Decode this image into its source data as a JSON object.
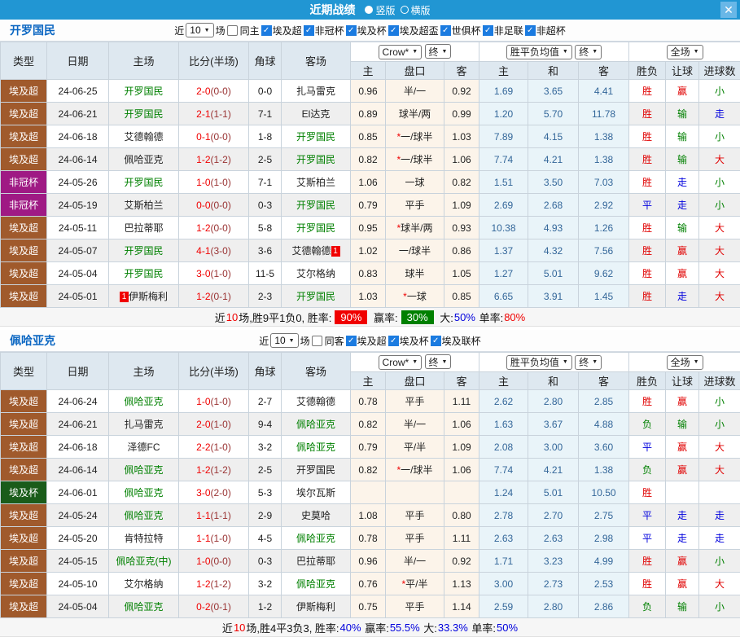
{
  "titlebar": {
    "title": "近期战绩",
    "radios": [
      {
        "label": "竖版",
        "selected": true
      },
      {
        "label": "横版",
        "selected": false
      }
    ],
    "close": "✕"
  },
  "table_header": {
    "main": [
      "类型",
      "日期",
      "主场",
      "比分(半场)",
      "角球",
      "客场"
    ],
    "selects_odds": [
      "Crow*",
      "终"
    ],
    "selects_avg": [
      "胜平负均值",
      "终"
    ],
    "selects_period": [
      "全场"
    ],
    "sub": [
      "主",
      "盘口",
      "客",
      "主",
      "和",
      "客",
      "胜负",
      "让球",
      "进球数"
    ]
  },
  "value_colors": {
    "胜": "v-red",
    "平": "v-blue",
    "负": "v-green",
    "赢": "v-red",
    "输": "v-green",
    "走": "v-blue",
    "大": "v-red",
    "小": "v-green"
  },
  "comp_colors": {
    "埃及超": "#a05a2c",
    "非冠杯": "#9f1a84",
    "埃及杯": "#1a5c1a"
  },
  "sections": [
    {
      "team": "开罗国民",
      "filter": {
        "prefix": "近",
        "count": "10",
        "suffix": "场",
        "same": "同主",
        "same_checked": false,
        "leagues": [
          "埃及超",
          "非冠杯",
          "埃及杯",
          "埃及超盃",
          "世俱杯",
          "非足联",
          "非超杯"
        ]
      },
      "rows": [
        {
          "type": "埃及超",
          "date": "24-06-25",
          "home": "开罗国民",
          "home_green": true,
          "score": "2-0",
          "half": "(0-0)",
          "corner": "0-0",
          "away": "扎马雷克",
          "away_green": false,
          "o1": "0.96",
          "star": false,
          "line": "半/一",
          "o2": "0.92",
          "a1": "1.69",
          "a2": "3.65",
          "a3": "4.41",
          "r": "胜",
          "h": "赢",
          "g": "小"
        },
        {
          "type": "埃及超",
          "date": "24-06-21",
          "home": "开罗国民",
          "home_green": true,
          "score": "2-1",
          "half": "(1-1)",
          "corner": "7-1",
          "away": "El达克",
          "away_green": false,
          "o1": "0.89",
          "star": false,
          "line": "球半/两",
          "o2": "0.99",
          "a1": "1.20",
          "a2": "5.70",
          "a3": "11.78",
          "r": "胜",
          "h": "输",
          "g": "走"
        },
        {
          "type": "埃及超",
          "date": "24-06-18",
          "home": "艾德翰德",
          "home_green": false,
          "score": "0-1",
          "half": "(0-0)",
          "corner": "1-8",
          "away": "开罗国民",
          "away_green": true,
          "o1": "0.85",
          "star": true,
          "line": "一/球半",
          "o2": "1.03",
          "a1": "7.89",
          "a2": "4.15",
          "a3": "1.38",
          "r": "胜",
          "h": "输",
          "g": "小"
        },
        {
          "type": "埃及超",
          "date": "24-06-14",
          "home": "佩哈亚克",
          "home_green": false,
          "score": "1-2",
          "half": "(1-2)",
          "corner": "2-5",
          "away": "开罗国民",
          "away_green": true,
          "o1": "0.82",
          "star": true,
          "line": "一/球半",
          "o2": "1.06",
          "a1": "7.74",
          "a2": "4.21",
          "a3": "1.38",
          "r": "胜",
          "h": "输",
          "g": "大"
        },
        {
          "type": "非冠杯",
          "date": "24-05-26",
          "home": "开罗国民",
          "home_green": true,
          "score": "1-0",
          "half": "(1-0)",
          "corner": "7-1",
          "away": "艾斯柏兰",
          "away_green": false,
          "o1": "1.06",
          "star": false,
          "line": "一球",
          "o2": "0.82",
          "a1": "1.51",
          "a2": "3.50",
          "a3": "7.03",
          "r": "胜",
          "h": "走",
          "g": "小"
        },
        {
          "type": "非冠杯",
          "date": "24-05-19",
          "home": "艾斯柏兰",
          "home_green": false,
          "score": "0-0",
          "half": "(0-0)",
          "corner": "0-3",
          "away": "开罗国民",
          "away_green": true,
          "o1": "0.79",
          "star": false,
          "line": "平手",
          "o2": "1.09",
          "a1": "2.69",
          "a2": "2.68",
          "a3": "2.92",
          "r": "平",
          "h": "走",
          "g": "小"
        },
        {
          "type": "埃及超",
          "date": "24-05-11",
          "home": "巴拉蒂耶",
          "home_green": false,
          "score": "1-2",
          "half": "(0-0)",
          "corner": "5-8",
          "away": "开罗国民",
          "away_green": true,
          "o1": "0.95",
          "star": true,
          "line": "球半/两",
          "o2": "0.93",
          "a1": "10.38",
          "a2": "4.93",
          "a3": "1.26",
          "r": "胜",
          "h": "输",
          "g": "大"
        },
        {
          "type": "埃及超",
          "date": "24-05-07",
          "home": "开罗国民",
          "home_green": true,
          "score": "4-1",
          "half": "(3-0)",
          "corner": "3-6",
          "away": "艾德翰德",
          "away_green": false,
          "away_badge": "1",
          "o1": "1.02",
          "star": false,
          "line": "一/球半",
          "o2": "0.86",
          "a1": "1.37",
          "a2": "4.32",
          "a3": "7.56",
          "r": "胜",
          "h": "赢",
          "g": "大"
        },
        {
          "type": "埃及超",
          "date": "24-05-04",
          "home": "开罗国民",
          "home_green": true,
          "score": "3-0",
          "half": "(1-0)",
          "corner": "11-5",
          "away": "艾尔格纳",
          "away_green": false,
          "o1": "0.83",
          "star": false,
          "line": "球半",
          "o2": "1.05",
          "a1": "1.27",
          "a2": "5.01",
          "a3": "9.62",
          "r": "胜",
          "h": "赢",
          "g": "大"
        },
        {
          "type": "埃及超",
          "date": "24-05-01",
          "home": "伊斯梅利",
          "home_green": false,
          "home_badge": "1",
          "score": "1-2",
          "half": "(0-1)",
          "corner": "2-3",
          "away": "开罗国民",
          "away_green": true,
          "o1": "1.03",
          "star": true,
          "line": "一球",
          "o2": "0.85",
          "a1": "6.65",
          "a2": "3.91",
          "a3": "1.45",
          "r": "胜",
          "h": "走",
          "g": "大"
        }
      ],
      "summary": [
        {
          "t": "近"
        },
        {
          "t": "10",
          "s": "red"
        },
        {
          "t": "场,胜9平1负0, 胜率:"
        },
        {
          "t": "90%",
          "s": "badge-red"
        },
        {
          "t": " 赢率:"
        },
        {
          "t": "30%",
          "s": "badge-green"
        },
        {
          "t": " 大:"
        },
        {
          "t": "50%",
          "s": "blue"
        },
        {
          "t": " 单率:"
        },
        {
          "t": "80%",
          "s": "red"
        }
      ]
    },
    {
      "team": "佩哈亚克",
      "filter": {
        "prefix": "近",
        "count": "10",
        "suffix": "场",
        "same": "同客",
        "same_checked": false,
        "leagues": [
          "埃及超",
          "埃及杯",
          "埃及联杯"
        ]
      },
      "rows": [
        {
          "type": "埃及超",
          "date": "24-06-24",
          "home": "佩哈亚克",
          "home_green": true,
          "score": "1-0",
          "half": "(1-0)",
          "corner": "2-7",
          "away": "艾德翰德",
          "away_green": false,
          "o1": "0.78",
          "star": false,
          "line": "平手",
          "o2": "1.11",
          "a1": "2.62",
          "a2": "2.80",
          "a3": "2.85",
          "r": "胜",
          "h": "赢",
          "g": "小"
        },
        {
          "type": "埃及超",
          "date": "24-06-21",
          "home": "扎马雷克",
          "home_green": false,
          "score": "2-0",
          "half": "(1-0)",
          "corner": "9-4",
          "away": "佩哈亚克",
          "away_green": true,
          "o1": "0.82",
          "star": false,
          "line": "半/一",
          "o2": "1.06",
          "a1": "1.63",
          "a2": "3.67",
          "a3": "4.88",
          "r": "负",
          "h": "输",
          "g": "小"
        },
        {
          "type": "埃及超",
          "date": "24-06-18",
          "home": "泽德FC",
          "home_green": false,
          "score": "2-2",
          "half": "(1-0)",
          "corner": "3-2",
          "away": "佩哈亚克",
          "away_green": true,
          "o1": "0.79",
          "star": false,
          "line": "平/半",
          "o2": "1.09",
          "a1": "2.08",
          "a2": "3.00",
          "a3": "3.60",
          "r": "平",
          "h": "赢",
          "g": "大"
        },
        {
          "type": "埃及超",
          "date": "24-06-14",
          "home": "佩哈亚克",
          "home_green": true,
          "score": "1-2",
          "half": "(1-2)",
          "corner": "2-5",
          "away": "开罗国民",
          "away_green": false,
          "o1": "0.82",
          "star": true,
          "line": "一/球半",
          "o2": "1.06",
          "a1": "7.74",
          "a2": "4.21",
          "a3": "1.38",
          "r": "负",
          "h": "赢",
          "g": "大"
        },
        {
          "type": "埃及杯",
          "date": "24-06-01",
          "home": "佩哈亚克",
          "home_green": true,
          "score": "3-0",
          "half": "(2-0)",
          "corner": "5-3",
          "away": "埃尔瓦斯",
          "away_green": false,
          "o1": "",
          "star": false,
          "line": "",
          "o2": "",
          "a1": "1.24",
          "a2": "5.01",
          "a3": "10.50",
          "r": "胜",
          "h": "",
          "g": ""
        },
        {
          "type": "埃及超",
          "date": "24-05-24",
          "home": "佩哈亚克",
          "home_green": true,
          "score": "1-1",
          "half": "(1-1)",
          "corner": "2-9",
          "away": "史莫哈",
          "away_green": false,
          "o1": "1.08",
          "star": false,
          "line": "平手",
          "o2": "0.80",
          "a1": "2.78",
          "a2": "2.70",
          "a3": "2.75",
          "r": "平",
          "h": "走",
          "g": "走"
        },
        {
          "type": "埃及超",
          "date": "24-05-20",
          "home": "肯特拉特",
          "home_green": false,
          "score": "1-1",
          "half": "(1-0)",
          "corner": "4-5",
          "away": "佩哈亚克",
          "away_green": true,
          "o1": "0.78",
          "star": false,
          "line": "平手",
          "o2": "1.11",
          "a1": "2.63",
          "a2": "2.63",
          "a3": "2.98",
          "r": "平",
          "h": "走",
          "g": "走"
        },
        {
          "type": "埃及超",
          "date": "24-05-15",
          "home": "佩哈亚克(中)",
          "home_green": true,
          "score": "1-0",
          "half": "(0-0)",
          "corner": "0-3",
          "away": "巴拉蒂耶",
          "away_green": false,
          "o1": "0.96",
          "star": false,
          "line": "半/一",
          "o2": "0.92",
          "a1": "1.71",
          "a2": "3.23",
          "a3": "4.99",
          "r": "胜",
          "h": "赢",
          "g": "小"
        },
        {
          "type": "埃及超",
          "date": "24-05-10",
          "home": "艾尔格纳",
          "home_green": false,
          "score": "1-2",
          "half": "(1-2)",
          "corner": "3-2",
          "away": "佩哈亚克",
          "away_green": true,
          "o1": "0.76",
          "star": true,
          "line": "平/半",
          "o2": "1.13",
          "a1": "3.00",
          "a2": "2.73",
          "a3": "2.53",
          "r": "胜",
          "h": "赢",
          "g": "大"
        },
        {
          "type": "埃及超",
          "date": "24-05-04",
          "home": "佩哈亚克",
          "home_green": true,
          "score": "0-2",
          "half": "(0-1)",
          "corner": "1-2",
          "away": "伊斯梅利",
          "away_green": false,
          "o1": "0.75",
          "star": false,
          "line": "平手",
          "o2": "1.14",
          "a1": "2.59",
          "a2": "2.80",
          "a3": "2.86",
          "r": "负",
          "h": "输",
          "g": "小"
        }
      ],
      "summary": [
        {
          "t": "近"
        },
        {
          "t": "10",
          "s": "red"
        },
        {
          "t": "场,胜4平3负3, 胜率:"
        },
        {
          "t": "40%",
          "s": "blue"
        },
        {
          "t": " 赢率:"
        },
        {
          "t": "55.5%",
          "s": "blue"
        },
        {
          "t": " 大:"
        },
        {
          "t": "33.3%",
          "s": "blue"
        },
        {
          "t": " 单率:"
        },
        {
          "t": "50%",
          "s": "blue"
        }
      ]
    }
  ]
}
